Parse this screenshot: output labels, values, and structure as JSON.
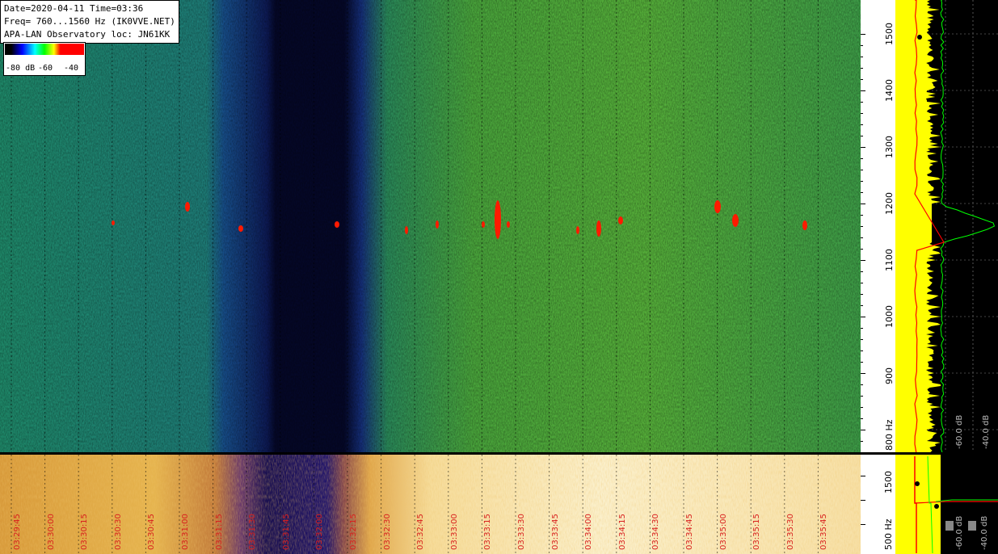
{
  "info": {
    "line1": "Date=2020-04-11 Time=03:36",
    "line2": "Freq= 760...1560 Hz (IK0VVE.NET)",
    "line3": "APA-LAN Observatory loc: JN61KK"
  },
  "color_scale": {
    "label_min": "-80 dB",
    "label_mid": "-60",
    "label_max": "-40"
  },
  "freq_axis_top": {
    "labels": [
      "1500",
      "1400",
      "1300",
      "1200",
      "1100",
      "1000",
      "900",
      "800 Hz"
    ],
    "values": [
      1500,
      1400,
      1300,
      1200,
      1100,
      1000,
      900,
      800
    ],
    "min": 760,
    "max": 1560
  },
  "freq_axis_bottom": {
    "labels": [
      "1500",
      "500 Hz"
    ]
  },
  "spectrum_labels": {
    "top_left": "-60.0 dB",
    "top_right": "-40.0 dB",
    "bottom_left": "-60.0 dB",
    "bottom_right": "-40.0 dB"
  },
  "time_labels": [
    "03:29:45",
    "03:30:00",
    "03:30:15",
    "03:30:30",
    "03:30:45",
    "03:31:00",
    "03:31:15",
    "03:31:30",
    "03:31:45",
    "03:32:00",
    "03:32:15",
    "03:32:30",
    "03:32:45",
    "03:33:00",
    "03:33:15",
    "03:33:30",
    "03:33:45",
    "03:34:00",
    "03:34:15",
    "03:34:30",
    "03:34:45",
    "03:35:00",
    "03:35:15",
    "03:35:30",
    "03:35:45"
  ],
  "colors": {
    "waterfall_background": "#2e9a4c",
    "dark_band": "#0a0a3a",
    "echo": "#ff1a00",
    "time_label": "#d8201e",
    "spectrum_fill": "#ffff00",
    "spectrum_peak": "#00ff00",
    "spectrum_avg": "#ff0000"
  }
}
